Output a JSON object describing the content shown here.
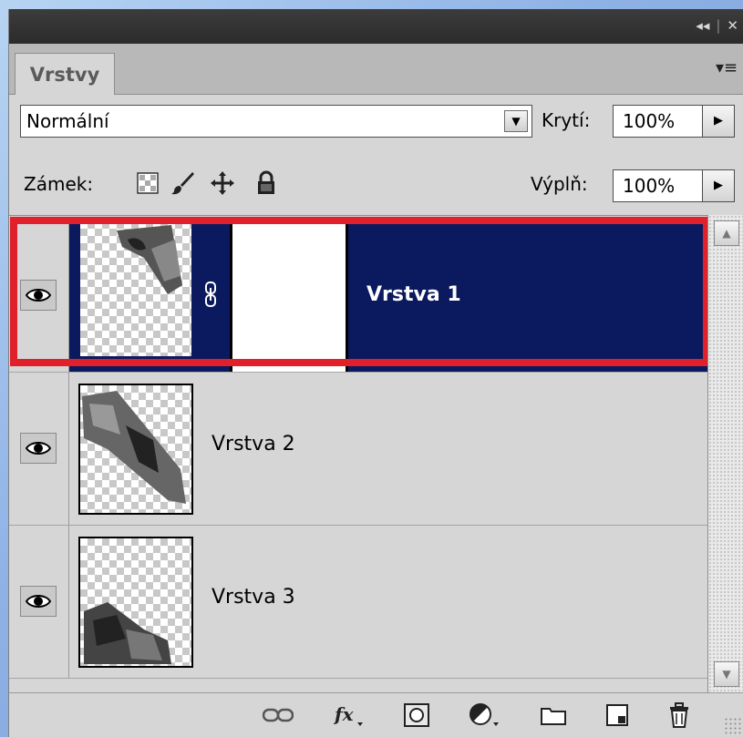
{
  "panel": {
    "tab_label": "Vrstvy",
    "blend_mode": "Normální",
    "opacity_label": "Krytí:",
    "opacity_value": "100%",
    "lock_label": "Zámek:",
    "fill_label": "Výplň:",
    "fill_value": "100%"
  },
  "layers": [
    {
      "name": "Vrstva 1",
      "selected": true,
      "visible": true,
      "has_mask": true
    },
    {
      "name": "Vrstva 2",
      "selected": false,
      "visible": true
    },
    {
      "name": "Vrstva 3",
      "selected": false,
      "visible": true
    }
  ],
  "colors": {
    "selection": "#0b1a5e",
    "highlight": "#e0202a",
    "panel_bg": "#d6d6d6"
  },
  "icons": {
    "lock_options": [
      "lock-transparency-icon",
      "lock-paint-icon",
      "lock-move-icon",
      "lock-all-icon"
    ],
    "bottom_bar": [
      "link-layers-icon",
      "layer-style-fx-icon",
      "add-mask-icon",
      "adjustment-layer-icon",
      "group-folder-icon",
      "new-layer-icon",
      "trash-icon"
    ]
  }
}
